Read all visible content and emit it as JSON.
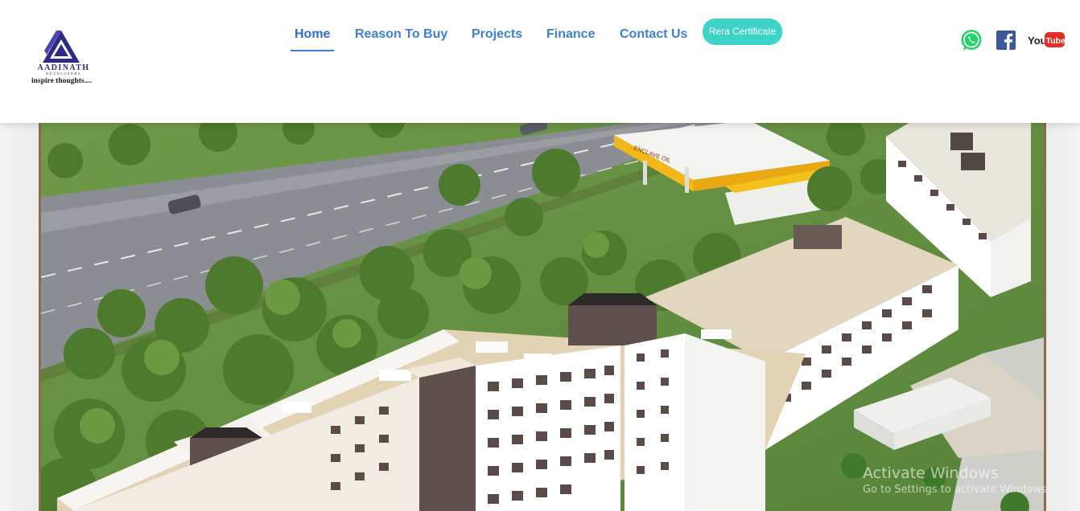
{
  "brand": {
    "name": "AADINATH",
    "subtitle": "DEVELOPERS",
    "tagline": "inspire thoughts....",
    "logo_icon": "triangle-logo-icon",
    "color": "#2e2a86"
  },
  "nav": {
    "items": [
      {
        "label": "Home",
        "active": true
      },
      {
        "label": "Reason To Buy",
        "active": false
      },
      {
        "label": "Projects",
        "active": false
      },
      {
        "label": "Finance",
        "active": false
      },
      {
        "label": "Contact Us",
        "active": false
      }
    ],
    "cta_label": "Rera Certificate",
    "link_color": "#3d7fd4",
    "cta_color": "#3dd3c8"
  },
  "social": [
    {
      "name": "whatsapp-icon",
      "color": "#25d366"
    },
    {
      "name": "facebook-icon",
      "color": "#3b5998"
    },
    {
      "name": "youtube-icon",
      "color": "#e52d27",
      "text_you": "You",
      "text_tube": "Tube"
    }
  ],
  "hero": {
    "image": "aerial-render-residential-buildings",
    "sign_text": "ENCLAVE OIL"
  },
  "watermark": {
    "title": "Activate Windows",
    "subtitle": "Go to Settings to activate Windows."
  }
}
